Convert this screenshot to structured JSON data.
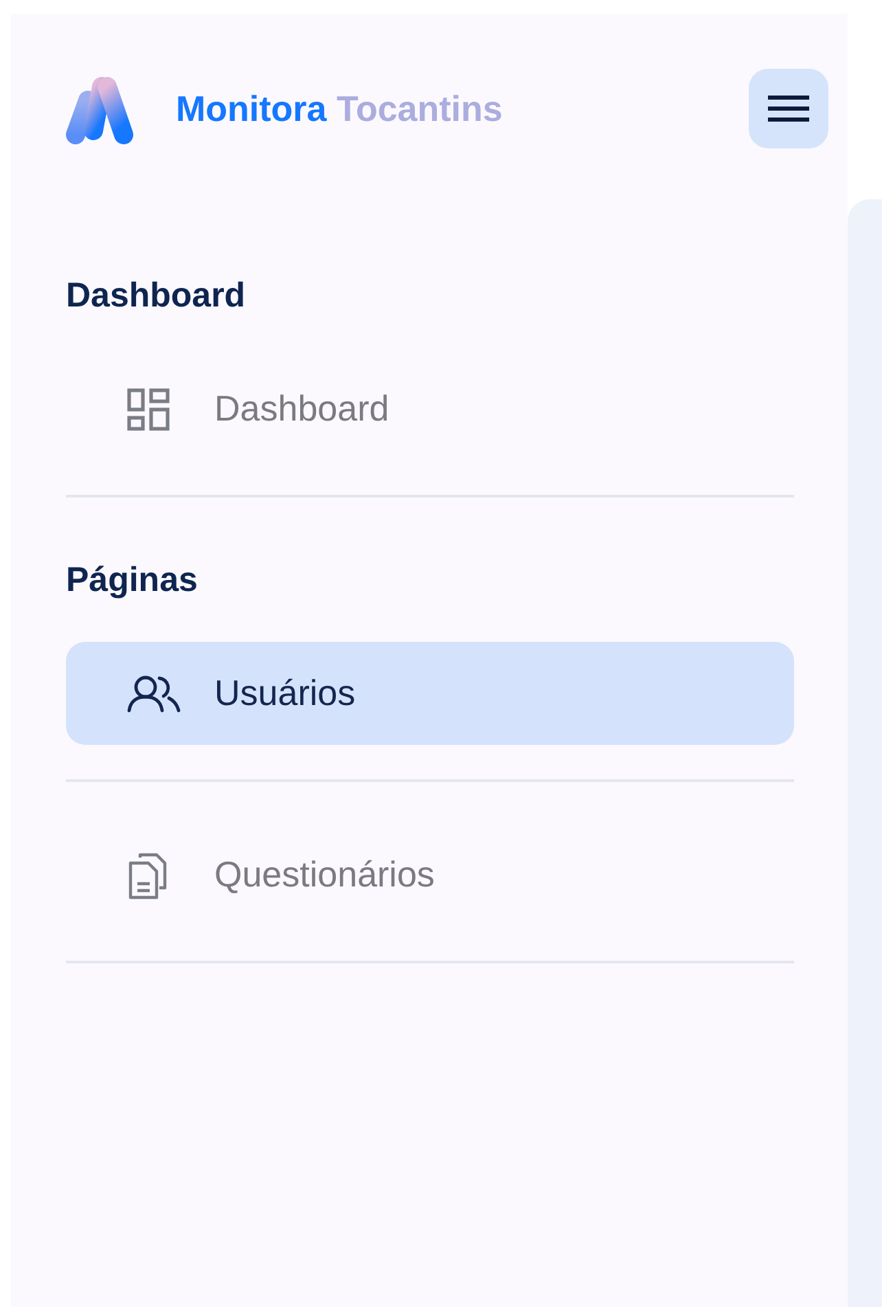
{
  "brand": {
    "name_primary": "Monitora",
    "name_secondary": "Tocantins"
  },
  "sections": [
    {
      "title": "Dashboard",
      "items": [
        {
          "label": "Dashboard",
          "kind": "grid",
          "selected": false
        }
      ]
    },
    {
      "title": "Páginas",
      "items": [
        {
          "label": "Usuários",
          "kind": "users",
          "selected": true
        },
        {
          "label": "Questionários",
          "kind": "documents",
          "selected": false
        }
      ]
    }
  ]
}
